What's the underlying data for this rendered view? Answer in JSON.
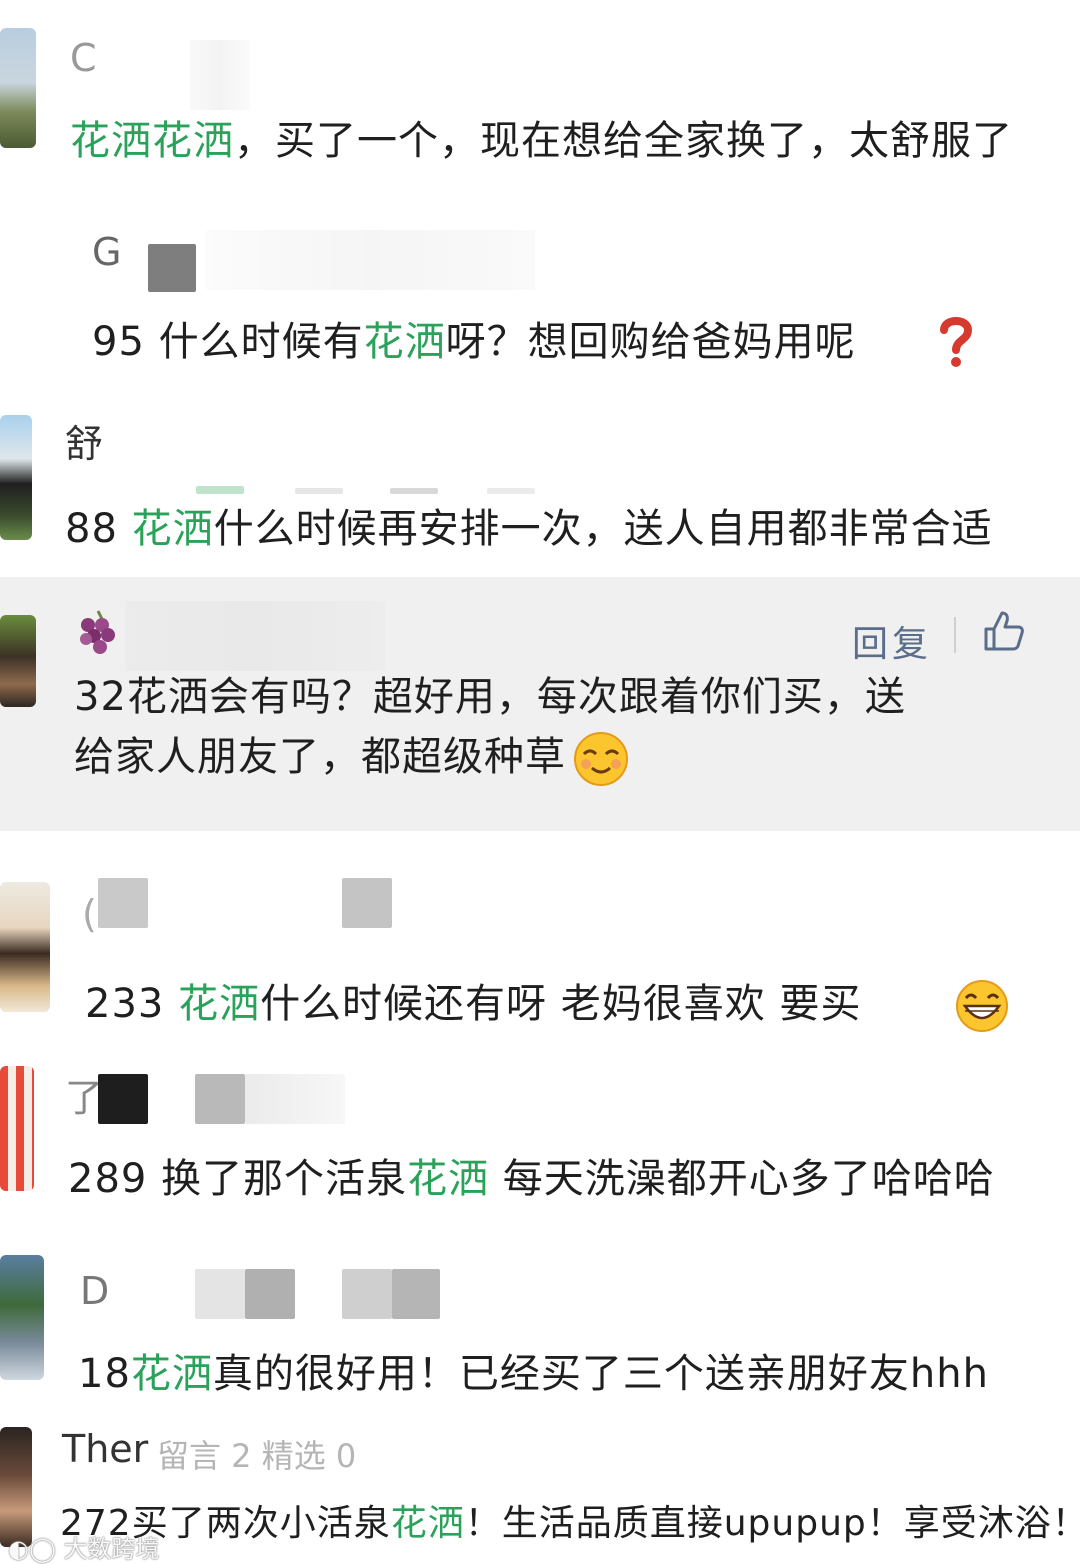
{
  "keyword": "花洒",
  "comments": [
    {
      "nick": "C",
      "segments": [
        {
          "t": "花洒花洒",
          "hl": true
        },
        {
          "t": "，买了一个，现在想给全家换了，太舒服了",
          "hl": false
        }
      ]
    },
    {
      "nick": "G",
      "segments": [
        {
          "t": "95 什么时候有",
          "hl": false
        },
        {
          "t": "花洒",
          "hl": true
        },
        {
          "t": "呀？想回购给爸妈用呢",
          "hl": false
        }
      ]
    },
    {
      "nick": "舒",
      "segments": [
        {
          "t": "88 ",
          "hl": false
        },
        {
          "t": "花洒",
          "hl": true
        },
        {
          "t": "什么时候再安排一次，送人自用都非常合适",
          "hl": false
        }
      ]
    },
    {
      "nick": "",
      "reply_label": "回复",
      "line1": "32花洒会有吗？超好用，每次跟着你们买，送",
      "line2": "给家人朋友了，都超级种草"
    },
    {
      "nick": "(",
      "segments": [
        {
          "t": "233 ",
          "hl": false
        },
        {
          "t": "花洒",
          "hl": true
        },
        {
          "t": "什么时候还有呀  老妈很喜欢  要买",
          "hl": false
        }
      ]
    },
    {
      "nick": "了",
      "segments": [
        {
          "t": "289 换了那个活泉",
          "hl": false
        },
        {
          "t": "花洒",
          "hl": true
        },
        {
          "t": " 每天洗澡都开心多了哈哈哈",
          "hl": false
        }
      ]
    },
    {
      "nick": "D",
      "segments": [
        {
          "t": "18",
          "hl": false
        },
        {
          "t": "花洒",
          "hl": true
        },
        {
          "t": "真的很好用！已经买了三个送亲朋好友hhh",
          "hl": false
        }
      ]
    },
    {
      "nick": "Ther",
      "meta": "留言 2 精选 0",
      "segments": [
        {
          "t": "272买了两次小活泉",
          "hl": false
        },
        {
          "t": "花洒",
          "hl": true
        },
        {
          "t": "！生活品质直接upupup！享受沐浴！",
          "hl": false
        }
      ]
    }
  ],
  "watermark": "大数跨境",
  "colors": {
    "highlight": "#2aa25a",
    "reply": "#5a6d8a",
    "selected_bg": "#f0f0f0"
  },
  "icons": [
    "question-mark-icon",
    "grape-icon",
    "thumbs-up-icon",
    "smiling-face-icon",
    "grinning-face-icon"
  ]
}
